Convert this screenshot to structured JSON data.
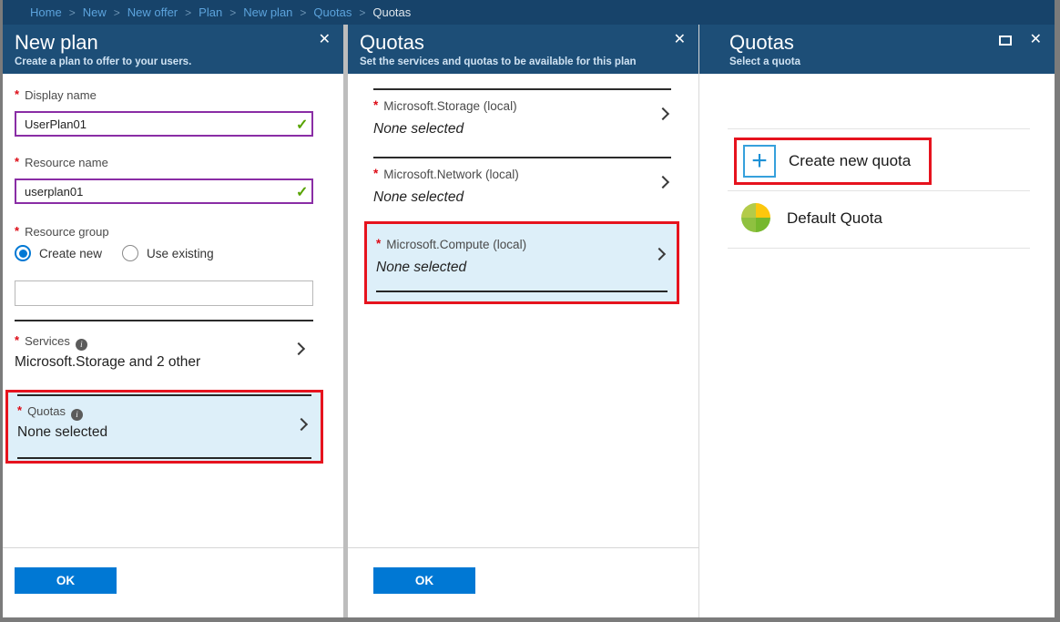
{
  "ui": {
    "required_marker": "*"
  },
  "icons": {
    "close": "✕",
    "check": "✓",
    "plus": "+"
  },
  "colors": {
    "topbar": "#17436a",
    "blade_header": "#1d4e77",
    "accent_blue": "#0078d4",
    "callout_red": "#e6131e",
    "highlight_blue": "#ddeff9",
    "valid_purple": "#8a2da5",
    "check_green": "#57a300",
    "pie_yellow": "#fcc70d",
    "pie_green_dark": "#76b82d",
    "pie_green": "#8fc140",
    "pie_yellow_green": "#b3cb4a"
  },
  "breadcrumb": {
    "separator": ">",
    "items": [
      "Home",
      "New",
      "New offer",
      "Plan",
      "New plan",
      "Quotas",
      "Quotas"
    ]
  },
  "blade1": {
    "title": "New plan",
    "subtitle": "Create a plan to offer to your users.",
    "display_name": {
      "label": "Display name",
      "value": "UserPlan01"
    },
    "resource_name": {
      "label": "Resource name",
      "value": "userplan01"
    },
    "resource_group": {
      "label": "Resource group",
      "options": [
        "Create new",
        "Use existing"
      ],
      "selected": "Create new",
      "new_group_value": ""
    },
    "services": {
      "label": "Services",
      "value": "Microsoft.Storage and 2 other"
    },
    "quotas": {
      "label": "Quotas",
      "value": "None selected"
    },
    "ok_label": "OK"
  },
  "blade2": {
    "title": "Quotas",
    "subtitle": "Set the services and quotas to be available for this plan",
    "rows": [
      {
        "label": "Microsoft.Storage (local)",
        "value": "None selected"
      },
      {
        "label": "Microsoft.Network (local)",
        "value": "None selected"
      },
      {
        "label": "Microsoft.Compute (local)",
        "value": "None selected"
      }
    ],
    "ok_label": "OK"
  },
  "blade3": {
    "title": "Quotas",
    "subtitle": "Select a quota",
    "create_new_label": "Create new quota",
    "items": [
      {
        "label": "Default Quota"
      }
    ]
  }
}
